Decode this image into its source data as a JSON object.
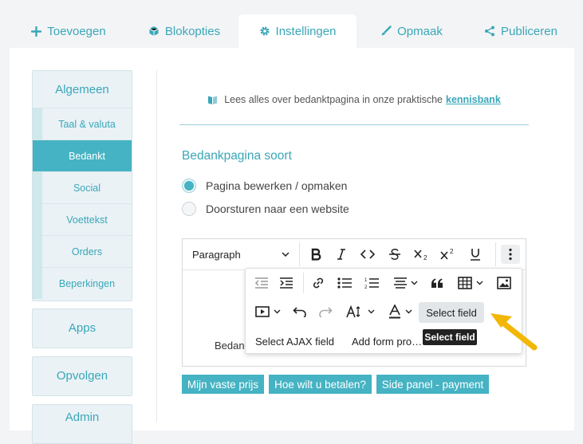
{
  "tabs": [
    {
      "label": "Toevoegen",
      "icon": "plus-icon"
    },
    {
      "label": "Blokopties",
      "icon": "cube-icon"
    },
    {
      "label": "Instellingen",
      "icon": "gear-icon",
      "active": true
    },
    {
      "label": "Opmaak",
      "icon": "brush-icon"
    },
    {
      "label": "Publiceren",
      "icon": "share-icon"
    }
  ],
  "sidebar": {
    "group1": {
      "title": "Algemeen",
      "items": [
        "Taal & valuta",
        "Bedankt",
        "Social",
        "Voettekst",
        "Orders",
        "Beperkingen"
      ],
      "active": "Bedankt"
    },
    "apps": "Apps",
    "opvolgen": "Opvolgen",
    "partial": "Admin"
  },
  "info": {
    "text": "Lees alles over bedanktpagina in onze praktische",
    "link": "kennisbank",
    "icon": "book-icon"
  },
  "section": {
    "title": "Bedankpagina soort",
    "options": [
      "Pagina bewerken / opmaken",
      "Doorsturen naar een website"
    ],
    "selected": 0
  },
  "editor": {
    "block_format": "Paragraph",
    "content_partial": "Bedan",
    "toolbar_icons": [
      "bold-icon",
      "italic-icon",
      "code-icon",
      "strikethrough-icon",
      "subscript-icon",
      "superscript-icon",
      "underline-icon",
      "more-vertical-icon"
    ],
    "overflow": {
      "row1_icons": [
        "outdent-icon",
        "indent-icon",
        "link-icon",
        "bullet-list-icon",
        "numbered-list-icon",
        "align-icon",
        "quote-icon",
        "table-icon",
        "image-icon"
      ],
      "row2_icons": [
        "media-icon",
        "undo-icon",
        "redo-icon",
        "font-size-icon",
        "font-color-icon"
      ],
      "select_field": "Select field",
      "select_ajax": "Select AJAX field",
      "add_form": "Add form pro…"
    },
    "tooltip": "Select field"
  },
  "chips": [
    "Mijn vaste prijs",
    "Hoe wilt u betalen?",
    "Side panel - payment"
  ],
  "colors": {
    "accent": "#45b3c3",
    "accent_text": "#3aa7b8",
    "arrow": "#f2b705"
  }
}
